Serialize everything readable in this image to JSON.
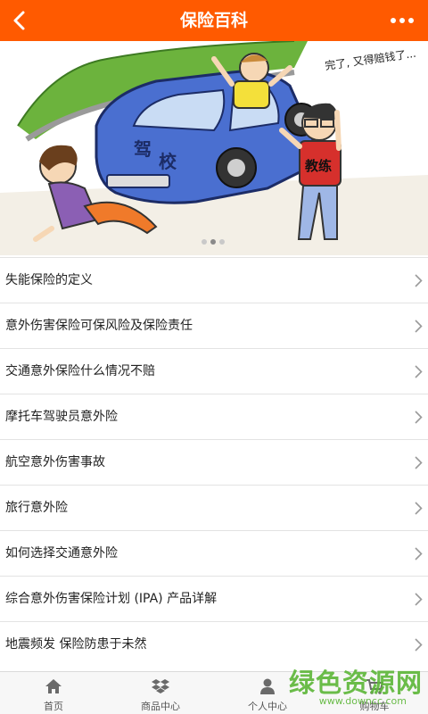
{
  "header": {
    "title": "保险百科",
    "background_color": "#ff5a00",
    "back_icon": "chevron-left-icon",
    "more_icon": "more-dots-icon"
  },
  "banner": {
    "image": "cartoon-car-accident-illustration",
    "car_text_1": "驾",
    "car_text_2": "校",
    "shirt_text": "教练",
    "speech_text": "完了, 又得赔钱了..."
  },
  "articles": [
    {
      "title": "失能保险的定义"
    },
    {
      "title": "意外伤害保险可保风险及保险责任"
    },
    {
      "title": "交通意外保险什么情况不赔"
    },
    {
      "title": "摩托车驾驶员意外险"
    },
    {
      "title": "航空意外伤害事故"
    },
    {
      "title": "旅行意外险"
    },
    {
      "title": "如何选择交通意外险"
    },
    {
      "title": "综合意外伤害保险计划 (IPA) 产品详解"
    },
    {
      "title": "地震频发 保险防患于未然"
    }
  ],
  "tabbar": {
    "tabs": [
      {
        "label": "首页",
        "icon": "home-icon"
      },
      {
        "label": "商品中心",
        "icon": "dropbox-icon"
      },
      {
        "label": "个人中心",
        "icon": "user-icon"
      },
      {
        "label": "购物车",
        "icon": "cart-icon"
      }
    ]
  },
  "watermark": {
    "text": "绿色资源网",
    "url": "www.downcc.com"
  }
}
